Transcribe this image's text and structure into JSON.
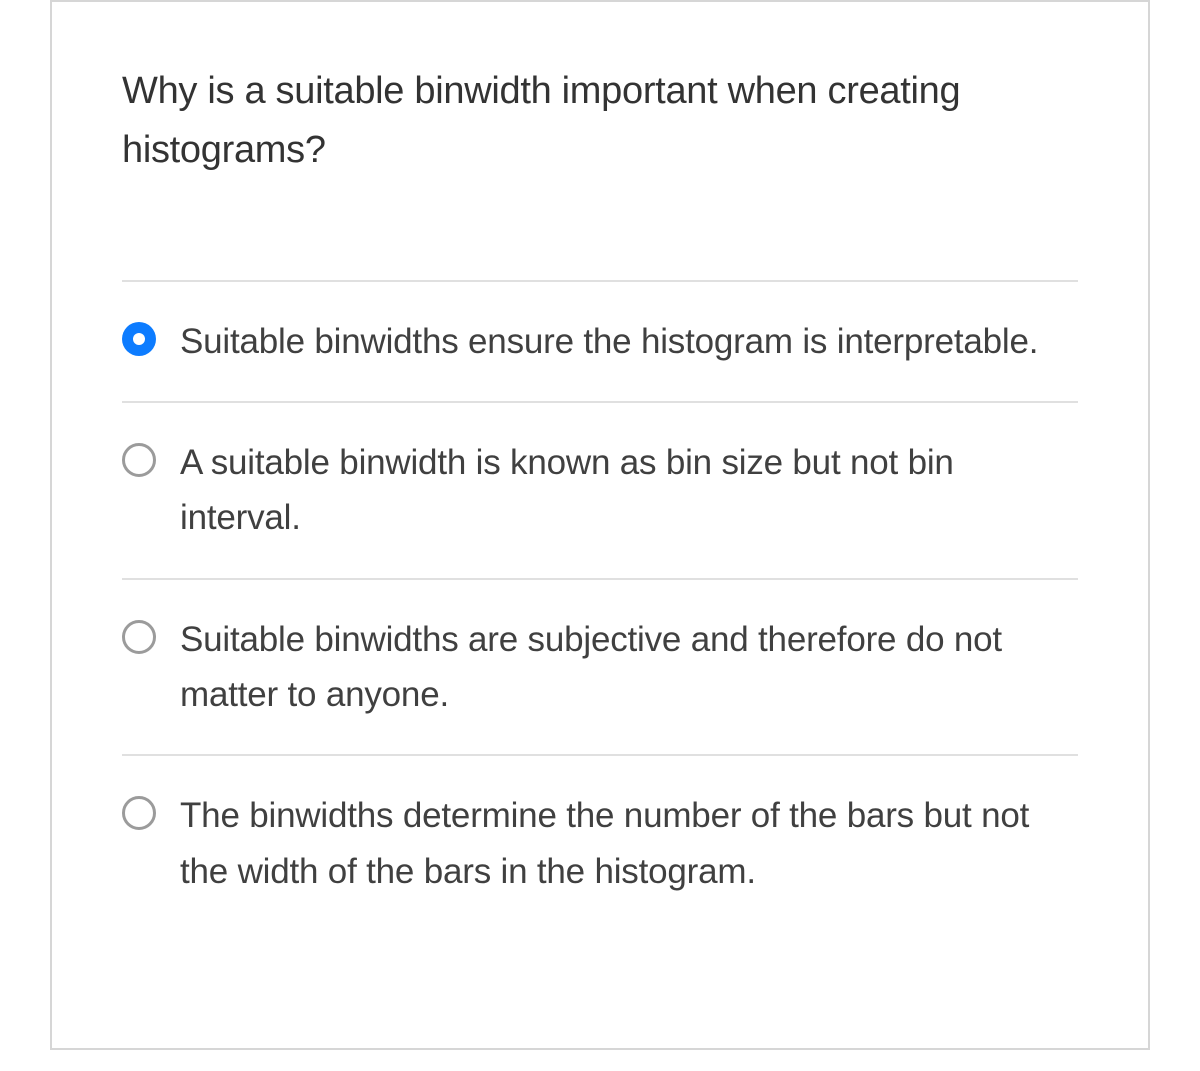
{
  "question": {
    "prompt": "Why is a suitable binwidth important when creating histograms?",
    "options": [
      {
        "text": "Suitable binwidths ensure the histogram is interpretable.",
        "selected": true
      },
      {
        "text": "A suitable binwidth is known as bin size but not bin interval.",
        "selected": false
      },
      {
        "text": "Suitable binwidths are subjective and therefore do not matter to anyone.",
        "selected": false
      },
      {
        "text": "The binwidths determine the number of the bars but not the width of the bars in the histogram.",
        "selected": false
      }
    ]
  },
  "colors": {
    "selected_radio": "#0d7cff",
    "border": "#d6d6d6",
    "divider": "#e0e0e0",
    "text": "#333333",
    "option_text": "#404040",
    "radio_ring": "#9b9b9b"
  }
}
